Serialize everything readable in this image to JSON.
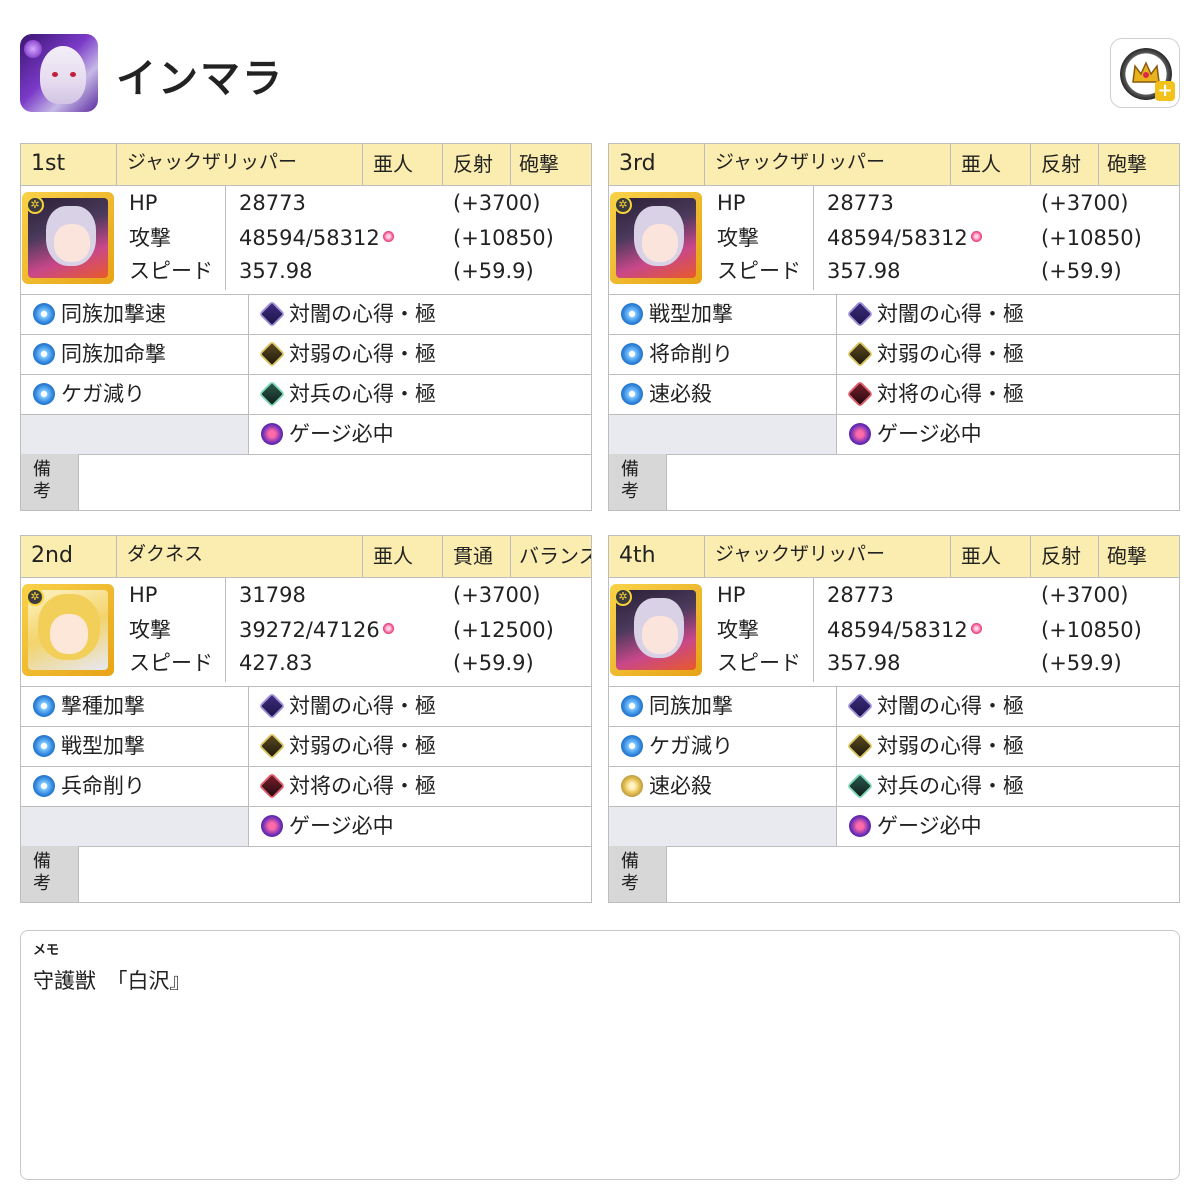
{
  "header": {
    "title": "インマラ",
    "boss_icon": "boss-portrait-icon",
    "crown_button": "crown-plus-icon"
  },
  "panels": [
    {
      "rank": "1st",
      "name": "ジャックザリッパー",
      "race": "亜人",
      "type": "反射",
      "style": "砲撃",
      "portrait": "jack-the-ripper-portrait",
      "stats": {
        "hp_label": "HP",
        "hp": "28773",
        "hp_plus": "(+3700)",
        "atk_label": "攻撃",
        "atk": "48594/58312",
        "atk_plus": "(+10850)",
        "spd_label": "スピード",
        "spd": "357.98",
        "spd_plus": "(+59.9)"
      },
      "skills_left": [
        "同族加撃速",
        "同族加命撃",
        "ケガ減り",
        ""
      ],
      "skills_right": [
        "対闇の心得・極",
        "対弱の心得・極",
        "対兵の心得・極",
        "ゲージ必中"
      ],
      "remarks_label": "備\n考"
    },
    {
      "rank": "3rd",
      "name": "ジャックザリッパー",
      "race": "亜人",
      "type": "反射",
      "style": "砲撃",
      "portrait": "jack-the-ripper-portrait",
      "stats": {
        "hp_label": "HP",
        "hp": "28773",
        "hp_plus": "(+3700)",
        "atk_label": "攻撃",
        "atk": "48594/58312",
        "atk_plus": "(+10850)",
        "spd_label": "スピード",
        "spd": "357.98",
        "spd_plus": "(+59.9)"
      },
      "skills_left": [
        "戦型加撃",
        "将命削り",
        "速必殺",
        ""
      ],
      "skills_right": [
        "対闇の心得・極",
        "対弱の心得・極",
        "対将の心得・極",
        "ゲージ必中"
      ],
      "remarks_label": "備\n考"
    },
    {
      "rank": "2nd",
      "name": "ダクネス",
      "race": "亜人",
      "type": "貫通",
      "style": "バランス",
      "portrait": "darkness-portrait",
      "stats": {
        "hp_label": "HP",
        "hp": "31798",
        "hp_plus": "(+3700)",
        "atk_label": "攻撃",
        "atk": "39272/47126",
        "atk_plus": "(+12500)",
        "spd_label": "スピード",
        "spd": "427.83",
        "spd_plus": "(+59.9)"
      },
      "skills_left": [
        "撃種加撃",
        "戦型加撃",
        "兵命削り",
        ""
      ],
      "skills_right": [
        "対闇の心得・極",
        "対弱の心得・極",
        "対将の心得・極",
        "ゲージ必中"
      ],
      "remarks_label": "備\n考"
    },
    {
      "rank": "4th",
      "name": "ジャックザリッパー",
      "race": "亜人",
      "type": "反射",
      "style": "砲撃",
      "portrait": "jack-the-ripper-portrait",
      "stats": {
        "hp_label": "HP",
        "hp": "28773",
        "hp_plus": "(+3700)",
        "atk_label": "攻撃",
        "atk": "48594/58312",
        "atk_plus": "(+10850)",
        "spd_label": "スピード",
        "spd": "357.98",
        "spd_plus": "(+59.9)"
      },
      "skills_left": [
        "同族加撃",
        "ケガ減り",
        "速必殺",
        ""
      ],
      "skills_right": [
        "対闇の心得・極",
        "対弱の心得・極",
        "対兵の心得・極",
        "ゲージ必中"
      ],
      "remarks_label": "備\n考"
    }
  ],
  "memo": {
    "label": "メモ",
    "text": "守護獣　「白沢』"
  }
}
